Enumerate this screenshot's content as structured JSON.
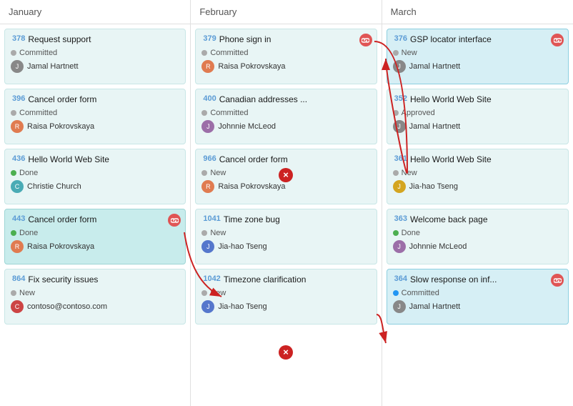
{
  "columns": [
    {
      "month": "January",
      "cards": [
        {
          "id": "378",
          "title": "Request support",
          "status": "Committed",
          "statusClass": "dot-committed",
          "assignee": "Jamal Hartnett",
          "avatarClass": "av-gray",
          "avatarInitial": "J",
          "hasLink": false,
          "highlighted": false,
          "highlightedBlue": false
        },
        {
          "id": "396",
          "title": "Cancel order form",
          "status": "Committed",
          "statusClass": "dot-committed",
          "assignee": "Raisa Pokrovskaya",
          "avatarClass": "av-orange",
          "avatarInitial": "R",
          "hasLink": false,
          "highlighted": false,
          "highlightedBlue": false
        },
        {
          "id": "436",
          "title": "Hello World Web Site",
          "status": "Done",
          "statusClass": "dot-done",
          "assignee": "Christie Church",
          "avatarClass": "av-teal",
          "avatarInitial": "C",
          "hasLink": false,
          "highlighted": false,
          "highlightedBlue": false
        },
        {
          "id": "443",
          "title": "Cancel order form",
          "status": "Done",
          "statusClass": "dot-done",
          "assignee": "Raisa Pokrovskaya",
          "avatarClass": "av-orange",
          "avatarInitial": "R",
          "hasLink": true,
          "highlighted": true,
          "highlightedBlue": false
        },
        {
          "id": "864",
          "title": "Fix security issues",
          "status": "New",
          "statusClass": "dot-new",
          "assignee": "contoso@contoso.com",
          "avatarClass": "av-red",
          "avatarInitial": "C",
          "hasLink": false,
          "highlighted": false,
          "highlightedBlue": false
        }
      ]
    },
    {
      "month": "February",
      "cards": [
        {
          "id": "379",
          "title": "Phone sign in",
          "status": "Committed",
          "statusClass": "dot-committed",
          "assignee": "Raisa Pokrovskaya",
          "avatarClass": "av-orange",
          "avatarInitial": "R",
          "hasLink": true,
          "highlighted": false,
          "highlightedBlue": false
        },
        {
          "id": "400",
          "title": "Canadian addresses ...",
          "status": "Committed",
          "statusClass": "dot-committed",
          "assignee": "Johnnie McLeod",
          "avatarClass": "av-purple",
          "avatarInitial": "J",
          "hasLink": false,
          "highlighted": false,
          "highlightedBlue": false
        },
        {
          "id": "966",
          "title": "Cancel order form",
          "status": "New",
          "statusClass": "dot-new",
          "assignee": "Raisa Pokrovskaya",
          "avatarClass": "av-orange",
          "avatarInitial": "R",
          "hasLink": false,
          "highlighted": false,
          "highlightedBlue": false
        },
        {
          "id": "1041",
          "title": "Time zone bug",
          "status": "New",
          "statusClass": "dot-new",
          "assignee": "Jia-hao Tseng",
          "avatarClass": "av-blue",
          "avatarInitial": "J",
          "hasLink": false,
          "highlighted": false,
          "highlightedBlue": false
        },
        {
          "id": "1042",
          "title": "Timezone clarification",
          "status": "New",
          "statusClass": "dot-new",
          "assignee": "Jia-hao Tseng",
          "avatarClass": "av-blue",
          "avatarInitial": "J",
          "hasLink": false,
          "highlighted": false,
          "highlightedBlue": false
        }
      ]
    },
    {
      "month": "March",
      "cards": [
        {
          "id": "376",
          "title": "GSP locator interface",
          "status": "New",
          "statusClass": "dot-new",
          "assignee": "Jamal Hartnett",
          "avatarClass": "av-gray",
          "avatarInitial": "J",
          "hasLink": true,
          "highlighted": false,
          "highlightedBlue": true
        },
        {
          "id": "352",
          "title": "Hello World Web Site",
          "status": "Approved",
          "statusClass": "dot-approved",
          "assignee": "Jamal Hartnett",
          "avatarClass": "av-gray",
          "avatarInitial": "J",
          "hasLink": false,
          "highlighted": false,
          "highlightedBlue": false
        },
        {
          "id": "361",
          "title": "Hello World Web Site",
          "status": "New",
          "statusClass": "dot-new",
          "assignee": "Jia-hao Tseng",
          "avatarClass": "av-yellow",
          "avatarInitial": "J",
          "hasLink": false,
          "highlighted": false,
          "highlightedBlue": false
        },
        {
          "id": "363",
          "title": "Welcome back page",
          "status": "Done",
          "statusClass": "dot-done",
          "assignee": "Johnnie McLeod",
          "avatarClass": "av-purple",
          "avatarInitial": "J",
          "hasLink": false,
          "highlighted": false,
          "highlightedBlue": false
        },
        {
          "id": "364",
          "title": "Slow response on inf...",
          "status": "Committed",
          "statusClass": "dot-committed-blue",
          "assignee": "Jamal Hartnett",
          "avatarClass": "av-gray",
          "avatarInitial": "J",
          "hasLink": true,
          "highlighted": false,
          "highlightedBlue": true
        }
      ]
    }
  ]
}
